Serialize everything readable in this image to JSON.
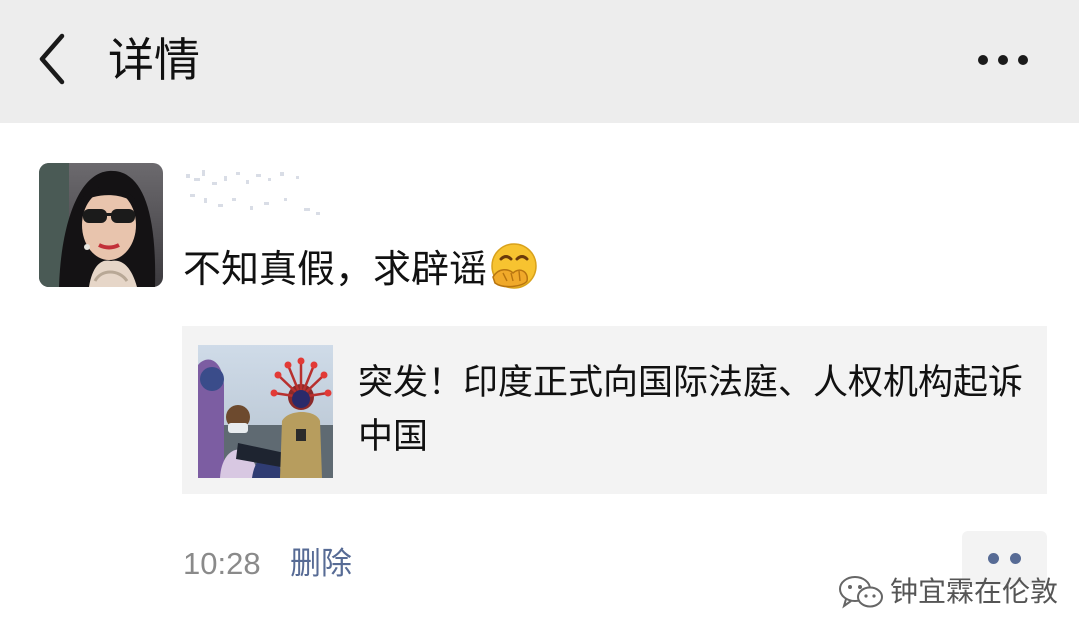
{
  "header": {
    "title": "详情",
    "back_icon": "chevron-left-icon",
    "more_icon": "more-dots-icon",
    "background": "#ededed"
  },
  "post": {
    "text": "不知真假，求辟谣",
    "emoji": "face-with-hand-over-mouth-emoji",
    "link": {
      "title": "突发！印度正式向国际法庭、人权机构起诉中国"
    },
    "time": "10:28",
    "delete_label": "删除",
    "action_icon": "comment-dots-icon"
  },
  "watermark": {
    "text": "钟宜霖在伦敦",
    "icon": "wechat-icon"
  },
  "colors": {
    "link_blue": "#576b95",
    "card_bg": "#f3f3f3",
    "time_gray": "#8a8a8a"
  }
}
